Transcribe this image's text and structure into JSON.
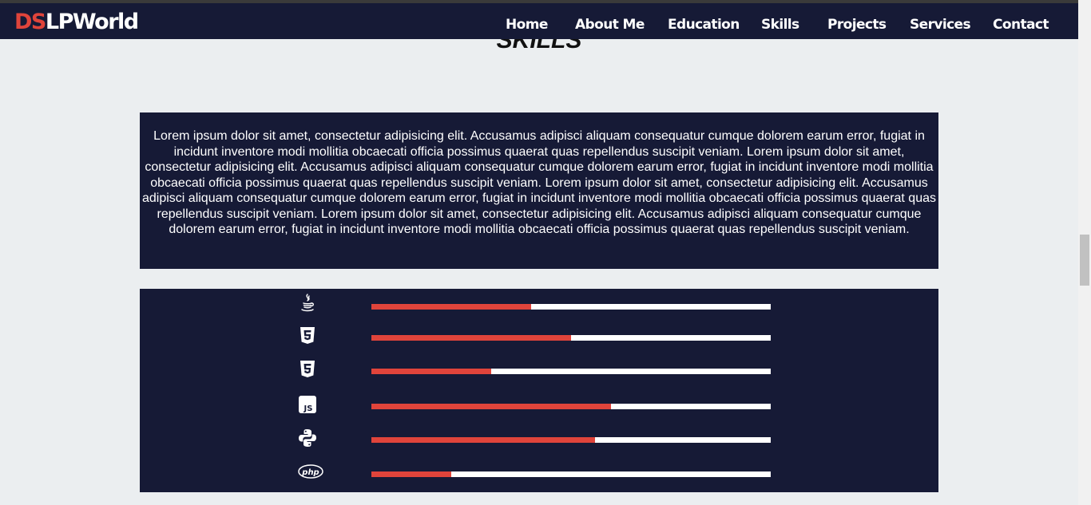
{
  "logo": {
    "part1": "DS",
    "part2": "LPWorld"
  },
  "nav": {
    "items": [
      "Home",
      "About Me",
      "Education",
      "Skills",
      "Projects",
      "Services",
      "Contact"
    ]
  },
  "section": {
    "title": "SKILLS"
  },
  "description": "Lorem ipsum dolor sit amet, consectetur adipisicing elit. Accusamus adipisci aliquam consequatur cumque dolorem earum error, fugiat in incidunt inventore modi mollitia obcaecati officia possimus quaerat quas repellendus suscipit veniam. Lorem ipsum dolor sit amet, consectetur adipisicing elit. Accusamus adipisci aliquam consequatur cumque dolorem earum error, fugiat in incidunt inventore modi mollitia obcaecati officia possimus quaerat quas repellendus suscipit veniam. Lorem ipsum dolor sit amet, consectetur adipisicing elit. Accusamus adipisci aliquam consequatur cumque dolorem earum error, fugiat in incidunt inventore modi mollitia obcaecati officia possimus quaerat quas repellendus suscipit veniam. Lorem ipsum dolor sit amet, consectetur adipisicing elit. Accusamus adipisci aliquam consequatur cumque dolorem earum error, fugiat in incidunt inventore modi mollitia obcaecati officia possimus quaerat quas repellendus suscipit veniam.",
  "skills": [
    {
      "icon": "java-icon",
      "level": 0.4
    },
    {
      "icon": "html5-icon",
      "level": 0.5
    },
    {
      "icon": "css3-icon",
      "level": 0.3
    },
    {
      "icon": "javascript-icon",
      "level": 0.6
    },
    {
      "icon": "python-icon",
      "level": 0.56
    },
    {
      "icon": "php-icon",
      "level": 0.2
    }
  ],
  "colors": {
    "navy": "#161a36",
    "accent": "#e0443b",
    "background": "#ebeef0",
    "track": "#ffffff"
  }
}
